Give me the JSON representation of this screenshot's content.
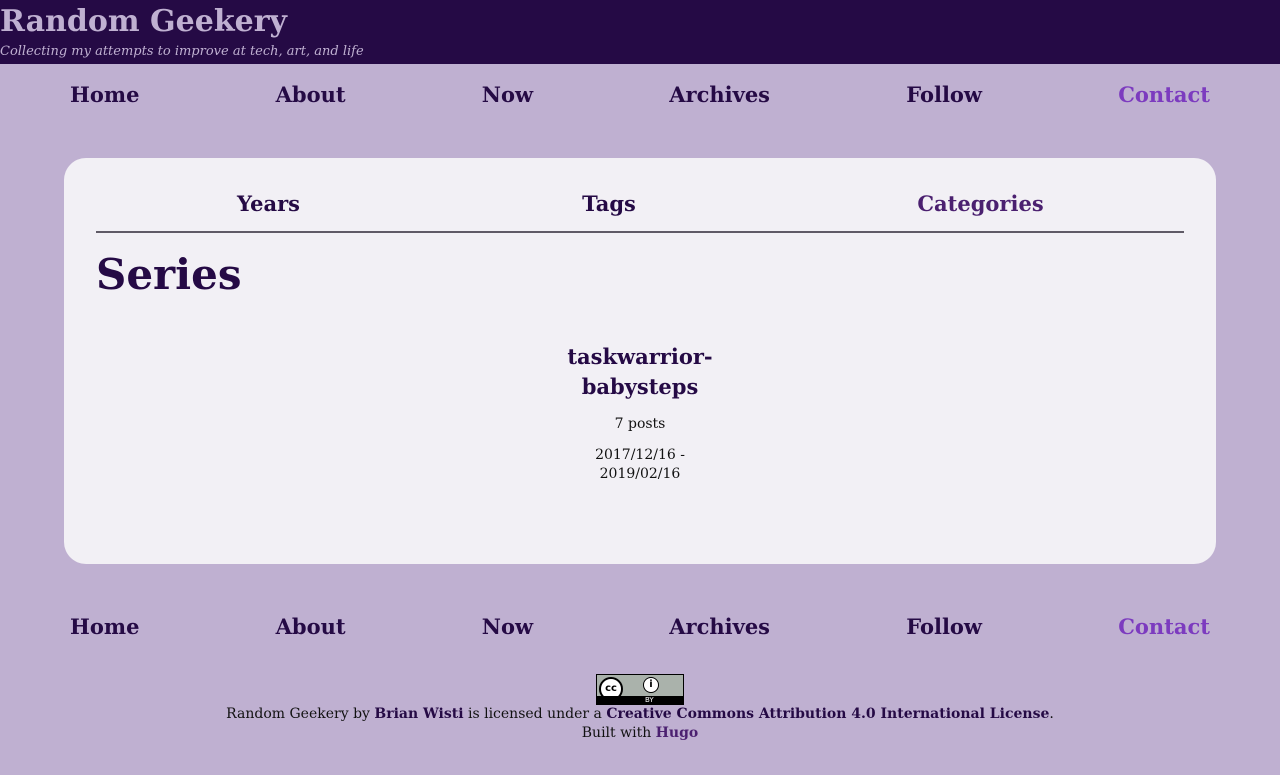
{
  "header": {
    "site_title": "Random Geekery",
    "tagline": "Collecting my attempts to improve at tech, art, and life"
  },
  "nav": {
    "items": [
      {
        "label": "Home"
      },
      {
        "label": "About"
      },
      {
        "label": "Now"
      },
      {
        "label": "Archives"
      },
      {
        "label": "Follow"
      },
      {
        "label": "Contact",
        "active": true
      }
    ]
  },
  "taxonomy_tabs": [
    {
      "label": "Years"
    },
    {
      "label": "Tags"
    },
    {
      "label": "Categories",
      "current": true
    }
  ],
  "main": {
    "title": "Series",
    "series": [
      {
        "name": "taskwarrior-babysteps",
        "count": "7 posts",
        "dates": "2017/12/16 - 2019/02/16"
      }
    ]
  },
  "footer": {
    "badge": {
      "cc": "cc",
      "by": "i",
      "by_label": "BY"
    },
    "license": {
      "prefix": "Random Geekery by",
      "author": "Brian Wisti",
      "middle": "is licensed under a",
      "license_name": "Creative Commons Attribution 4.0 International License",
      "suffix": ".",
      "built_with": "Built with",
      "hugo": "Hugo"
    }
  },
  "colors": {
    "header_bg": "#250a45",
    "page_bg": "#bfb0d1",
    "card_bg": "#f2f0f5",
    "accent": "#7c3bbf"
  }
}
